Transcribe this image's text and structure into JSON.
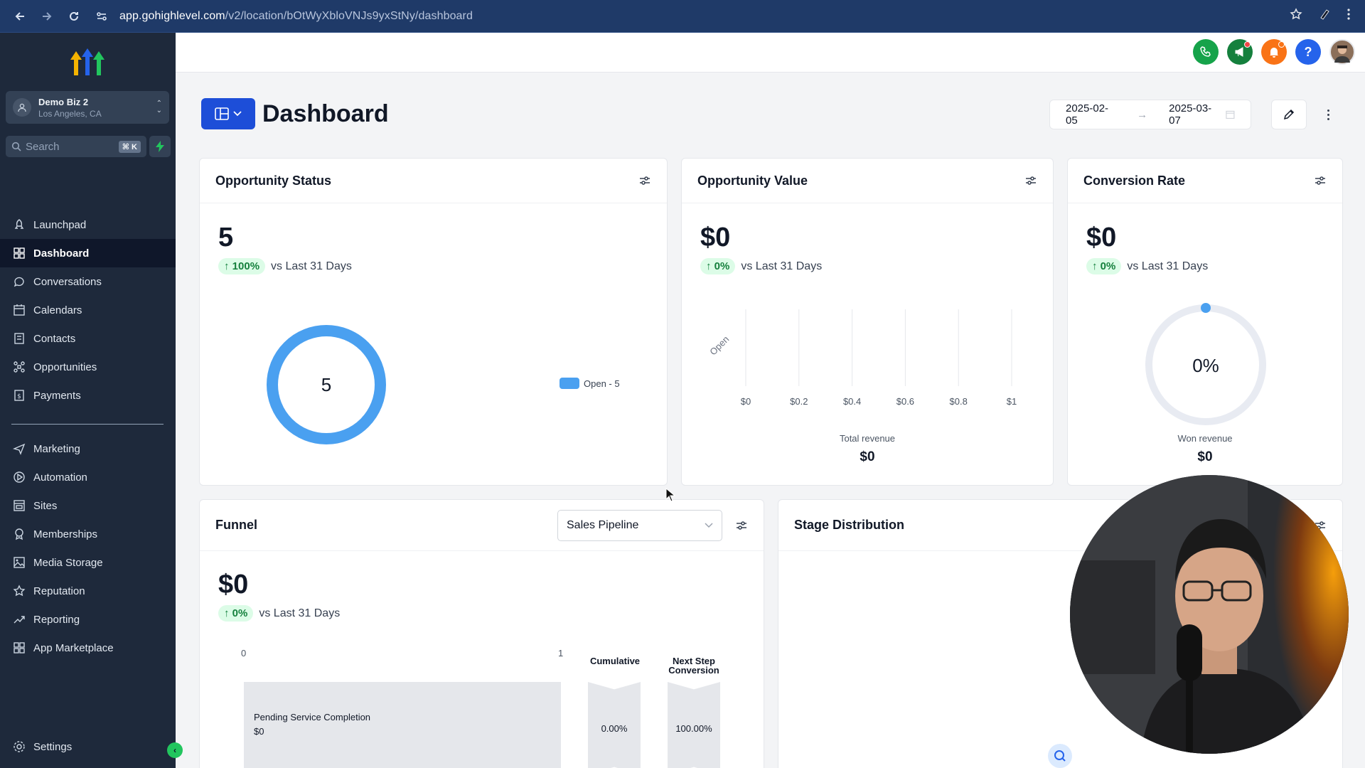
{
  "browser": {
    "url_host": "app.gohighlevel.com",
    "url_path": "/v2/location/bOtWyXbloVNJs9yxStNy/dashboard"
  },
  "sidebar": {
    "account": {
      "name": "Demo Biz 2",
      "location": "Los Angeles, CA"
    },
    "search": {
      "placeholder": "Search",
      "shortcut": "⌘ K"
    },
    "items": [
      {
        "label": "Launchpad",
        "icon": "rocket-icon"
      },
      {
        "label": "Dashboard",
        "icon": "grid-icon",
        "active": true
      },
      {
        "label": "Conversations",
        "icon": "chat-icon"
      },
      {
        "label": "Calendars",
        "icon": "calendar-icon"
      },
      {
        "label": "Contacts",
        "icon": "contacts-icon"
      },
      {
        "label": "Opportunities",
        "icon": "opportunities-icon"
      },
      {
        "label": "Payments",
        "icon": "payments-icon"
      }
    ],
    "items2": [
      {
        "label": "Marketing",
        "icon": "send-icon"
      },
      {
        "label": "Automation",
        "icon": "automation-icon"
      },
      {
        "label": "Sites",
        "icon": "sites-icon"
      },
      {
        "label": "Memberships",
        "icon": "membership-icon"
      },
      {
        "label": "Media Storage",
        "icon": "image-icon"
      },
      {
        "label": "Reputation",
        "icon": "star-icon"
      },
      {
        "label": "Reporting",
        "icon": "trend-icon"
      },
      {
        "label": "App Marketplace",
        "icon": "apps-icon"
      }
    ],
    "settings_label": "Settings"
  },
  "header": {
    "title": "Dashboard",
    "date_from": "2025-02-05",
    "date_to": "2025-03-07",
    "icon_colors": {
      "phone": "#16a34a",
      "announce": "#15803d",
      "bell": "#f97316",
      "help": "#2563eb"
    }
  },
  "cards": {
    "opportunity_status": {
      "title": "Opportunity Status",
      "value": "5",
      "delta": "100%",
      "compare": "vs Last 31 Days",
      "donut_center": "5",
      "legend": "Open - 5"
    },
    "opportunity_value": {
      "title": "Opportunity Value",
      "value": "$0",
      "delta": "0%",
      "compare": "vs Last 31 Days",
      "total_label": "Total revenue",
      "total_value": "$0"
    },
    "conversion_rate": {
      "title": "Conversion Rate",
      "value": "$0",
      "delta": "0%",
      "compare": "vs Last 31 Days",
      "gauge_center": "0%",
      "won_label": "Won revenue",
      "won_value": "$0"
    },
    "funnel": {
      "title": "Funnel",
      "pipeline": "Sales Pipeline",
      "value": "$0",
      "delta": "0%",
      "compare": "vs Last 31 Days",
      "axis_min": "0",
      "axis_max": "1",
      "col_cumulative": "Cumulative",
      "col_next": "Next Step Conversion",
      "stage_label": "Pending Service Completion",
      "stage_value": "$0",
      "cumulative_value": "0.00%",
      "next_value": "100.00%"
    },
    "stage_distribution": {
      "title": "Stage Distribution"
    }
  },
  "chart_data": [
    {
      "type": "pie",
      "categories": [
        "Open"
      ],
      "values": [
        5
      ]
    },
    {
      "type": "bar",
      "categories": [
        "Open"
      ],
      "values": [
        0
      ],
      "xlabel": "",
      "xlim": [
        0,
        1
      ],
      "xticks": [
        "$0",
        "$0.2",
        "$0.4",
        "$0.6",
        "$0.8",
        "$1"
      ]
    }
  ]
}
